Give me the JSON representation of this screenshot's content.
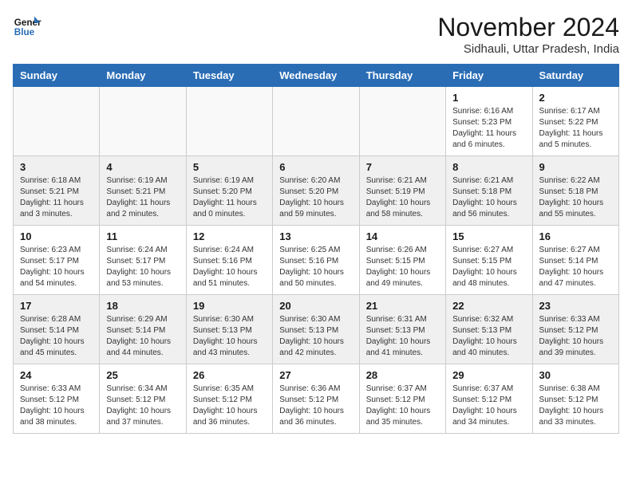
{
  "header": {
    "logo_line1": "General",
    "logo_line2": "Blue",
    "month_title": "November 2024",
    "subtitle": "Sidhauli, Uttar Pradesh, India"
  },
  "weekdays": [
    "Sunday",
    "Monday",
    "Tuesday",
    "Wednesday",
    "Thursday",
    "Friday",
    "Saturday"
  ],
  "weeks": [
    [
      {
        "day": "",
        "info": ""
      },
      {
        "day": "",
        "info": ""
      },
      {
        "day": "",
        "info": ""
      },
      {
        "day": "",
        "info": ""
      },
      {
        "day": "",
        "info": ""
      },
      {
        "day": "1",
        "info": "Sunrise: 6:16 AM\nSunset: 5:23 PM\nDaylight: 11 hours\nand 6 minutes."
      },
      {
        "day": "2",
        "info": "Sunrise: 6:17 AM\nSunset: 5:22 PM\nDaylight: 11 hours\nand 5 minutes."
      }
    ],
    [
      {
        "day": "3",
        "info": "Sunrise: 6:18 AM\nSunset: 5:21 PM\nDaylight: 11 hours\nand 3 minutes."
      },
      {
        "day": "4",
        "info": "Sunrise: 6:19 AM\nSunset: 5:21 PM\nDaylight: 11 hours\nand 2 minutes."
      },
      {
        "day": "5",
        "info": "Sunrise: 6:19 AM\nSunset: 5:20 PM\nDaylight: 11 hours\nand 0 minutes."
      },
      {
        "day": "6",
        "info": "Sunrise: 6:20 AM\nSunset: 5:20 PM\nDaylight: 10 hours\nand 59 minutes."
      },
      {
        "day": "7",
        "info": "Sunrise: 6:21 AM\nSunset: 5:19 PM\nDaylight: 10 hours\nand 58 minutes."
      },
      {
        "day": "8",
        "info": "Sunrise: 6:21 AM\nSunset: 5:18 PM\nDaylight: 10 hours\nand 56 minutes."
      },
      {
        "day": "9",
        "info": "Sunrise: 6:22 AM\nSunset: 5:18 PM\nDaylight: 10 hours\nand 55 minutes."
      }
    ],
    [
      {
        "day": "10",
        "info": "Sunrise: 6:23 AM\nSunset: 5:17 PM\nDaylight: 10 hours\nand 54 minutes."
      },
      {
        "day": "11",
        "info": "Sunrise: 6:24 AM\nSunset: 5:17 PM\nDaylight: 10 hours\nand 53 minutes."
      },
      {
        "day": "12",
        "info": "Sunrise: 6:24 AM\nSunset: 5:16 PM\nDaylight: 10 hours\nand 51 minutes."
      },
      {
        "day": "13",
        "info": "Sunrise: 6:25 AM\nSunset: 5:16 PM\nDaylight: 10 hours\nand 50 minutes."
      },
      {
        "day": "14",
        "info": "Sunrise: 6:26 AM\nSunset: 5:15 PM\nDaylight: 10 hours\nand 49 minutes."
      },
      {
        "day": "15",
        "info": "Sunrise: 6:27 AM\nSunset: 5:15 PM\nDaylight: 10 hours\nand 48 minutes."
      },
      {
        "day": "16",
        "info": "Sunrise: 6:27 AM\nSunset: 5:14 PM\nDaylight: 10 hours\nand 47 minutes."
      }
    ],
    [
      {
        "day": "17",
        "info": "Sunrise: 6:28 AM\nSunset: 5:14 PM\nDaylight: 10 hours\nand 45 minutes."
      },
      {
        "day": "18",
        "info": "Sunrise: 6:29 AM\nSunset: 5:14 PM\nDaylight: 10 hours\nand 44 minutes."
      },
      {
        "day": "19",
        "info": "Sunrise: 6:30 AM\nSunset: 5:13 PM\nDaylight: 10 hours\nand 43 minutes."
      },
      {
        "day": "20",
        "info": "Sunrise: 6:30 AM\nSunset: 5:13 PM\nDaylight: 10 hours\nand 42 minutes."
      },
      {
        "day": "21",
        "info": "Sunrise: 6:31 AM\nSunset: 5:13 PM\nDaylight: 10 hours\nand 41 minutes."
      },
      {
        "day": "22",
        "info": "Sunrise: 6:32 AM\nSunset: 5:13 PM\nDaylight: 10 hours\nand 40 minutes."
      },
      {
        "day": "23",
        "info": "Sunrise: 6:33 AM\nSunset: 5:12 PM\nDaylight: 10 hours\nand 39 minutes."
      }
    ],
    [
      {
        "day": "24",
        "info": "Sunrise: 6:33 AM\nSunset: 5:12 PM\nDaylight: 10 hours\nand 38 minutes."
      },
      {
        "day": "25",
        "info": "Sunrise: 6:34 AM\nSunset: 5:12 PM\nDaylight: 10 hours\nand 37 minutes."
      },
      {
        "day": "26",
        "info": "Sunrise: 6:35 AM\nSunset: 5:12 PM\nDaylight: 10 hours\nand 36 minutes."
      },
      {
        "day": "27",
        "info": "Sunrise: 6:36 AM\nSunset: 5:12 PM\nDaylight: 10 hours\nand 36 minutes."
      },
      {
        "day": "28",
        "info": "Sunrise: 6:37 AM\nSunset: 5:12 PM\nDaylight: 10 hours\nand 35 minutes."
      },
      {
        "day": "29",
        "info": "Sunrise: 6:37 AM\nSunset: 5:12 PM\nDaylight: 10 hours\nand 34 minutes."
      },
      {
        "day": "30",
        "info": "Sunrise: 6:38 AM\nSunset: 5:12 PM\nDaylight: 10 hours\nand 33 minutes."
      }
    ]
  ]
}
